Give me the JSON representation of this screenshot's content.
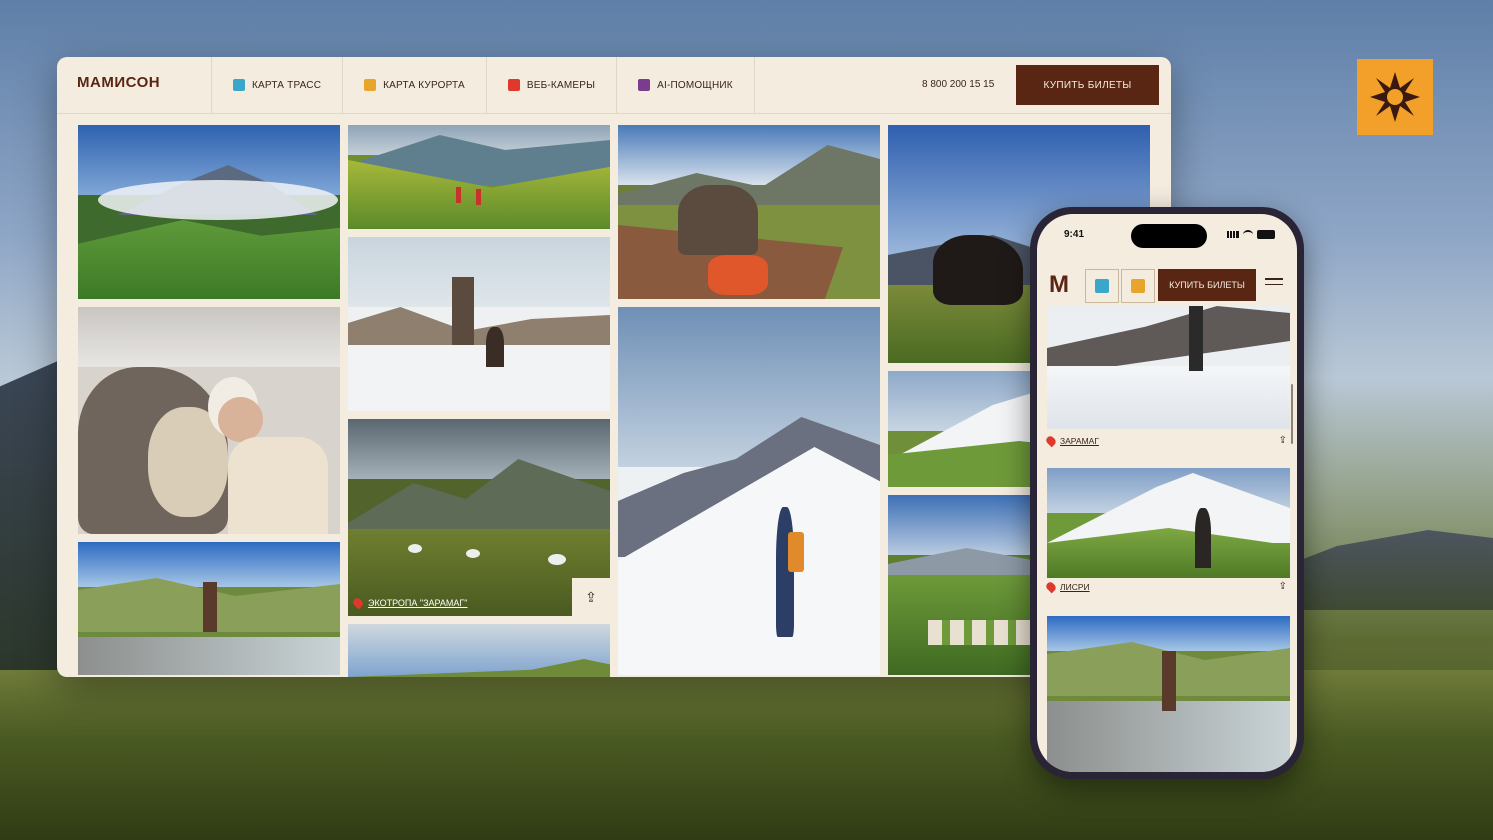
{
  "desktop": {
    "logo": "МАМИСОН",
    "nav": [
      {
        "label": "КАРТА ТРАСС",
        "icon": "skier-icon",
        "color": "#3aa6c9"
      },
      {
        "label": "КАРТА КУРОРТА",
        "icon": "map-icon",
        "color": "#e7a62b"
      },
      {
        "label": "ВЕБ-КАМЕРЫ",
        "icon": "camera-icon",
        "color": "#e0392b"
      },
      {
        "label": "AI-ПОМОЩНИК",
        "icon": "assistant-icon",
        "color": "#7b3c8e"
      }
    ],
    "phone": "8 800 200 15 15",
    "buy_label": "КУПИТЬ БИЛЕТЫ",
    "photo_caption": "ЭКОТРОПА \"ЗАРАМАГ\""
  },
  "mobile": {
    "time": "9:41",
    "logo": "M",
    "buy_label": "КУПИТЬ БИЛЕТЫ",
    "cards": [
      {
        "label": "ЗАРАМАГ"
      },
      {
        "label": "ЛИСРИ"
      }
    ]
  },
  "colors": {
    "brand": "#5a2614",
    "background": "#f4ecdf",
    "badge": "#f2a02a",
    "pin": "#e0392b"
  }
}
